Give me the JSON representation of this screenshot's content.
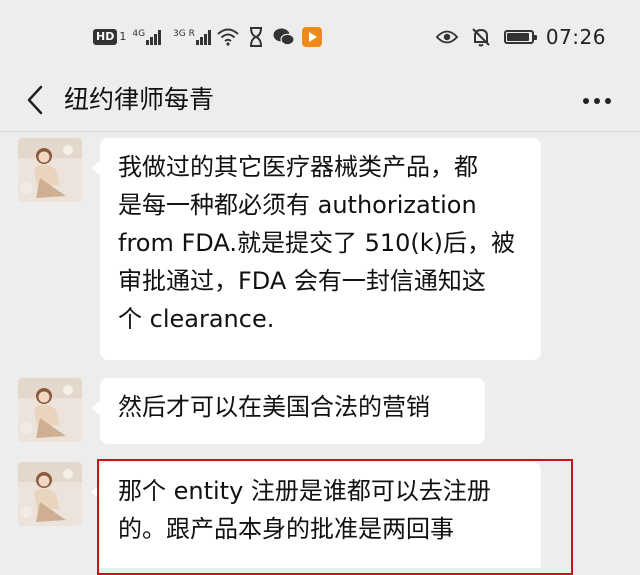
{
  "status_bar": {
    "hd_badge": "HD",
    "hd_badge_sub": "1",
    "network_1": "4G",
    "network_2": "3G R",
    "time": "07:26",
    "battery_level": 0.9
  },
  "header": {
    "title": "纽约律师每青"
  },
  "messages": [
    {
      "text": "我做过的其它医疗器械类产品，都\n是每一种都必须有 authorization\nfrom FDA.就是提交了 510(k)后，被\n审批通过，FDA 会有一封信通知这\n个 clearance."
    },
    {
      "text": "然后才可以在美国合法的营销"
    },
    {
      "text": "那个 entity 注册是谁都可以去注册\n的。跟产品本身的批准是两回事"
    }
  ],
  "colors": {
    "background": "#ededed",
    "bubble": "#ffffff",
    "highlight": "#c8141c"
  }
}
